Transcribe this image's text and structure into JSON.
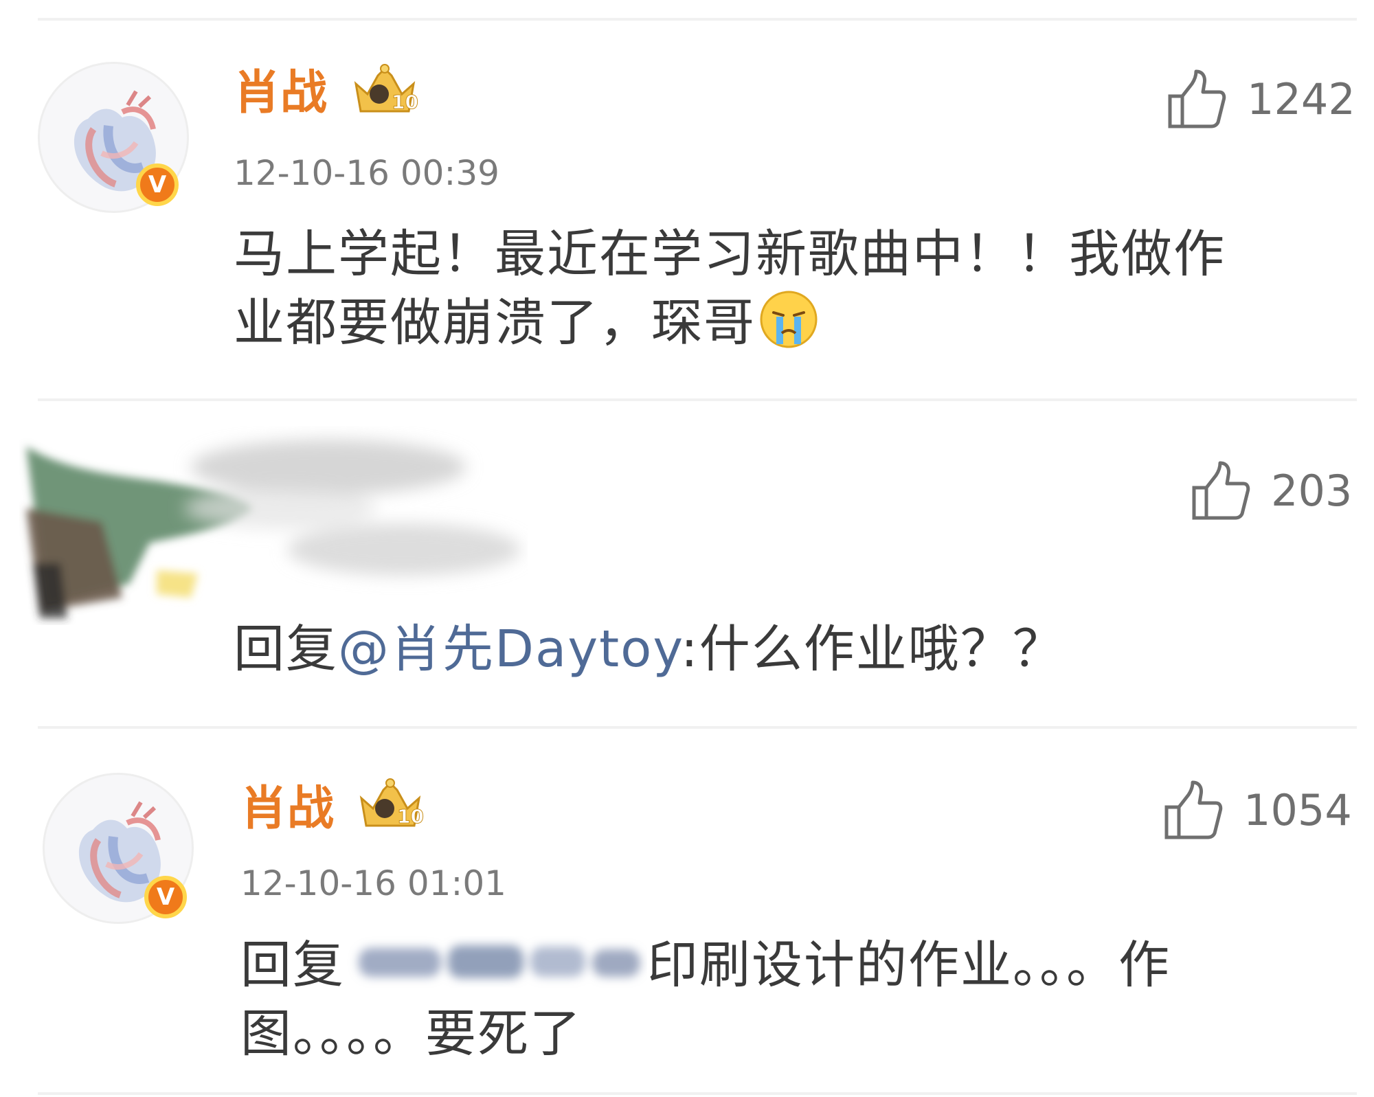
{
  "comments": [
    {
      "username": "肖战",
      "badge_icon": "vip-crown-level-10-icon",
      "badge_level": "10",
      "verified_icon": "verified-v-icon",
      "verified_letter": "V",
      "timestamp": "12-10-16 00:39",
      "likes": "1242",
      "text_line1": "马上学起！最近在学习新歌曲中！！我做作",
      "text_line2": "业都要做崩溃了，琛哥",
      "emoji": "crying-face-emoji"
    },
    {
      "username_hidden": true,
      "likes": "203",
      "reply_prefix": "回复",
      "mention": "@肖先Daytoy",
      "reply_text": ":什么作业哦？？"
    },
    {
      "username": "肖战",
      "badge_icon": "vip-crown-level-10-icon",
      "badge_level": "10",
      "verified_icon": "verified-v-icon",
      "verified_letter": "V",
      "timestamp": "12-10-16 01:01",
      "likes": "1054",
      "reply_prefix": "回复",
      "text_line1_rest": "印刷设计的作业。。。作",
      "text_line2": "图。。。。要死了"
    }
  ],
  "colors": {
    "username": "#e97b25",
    "mention": "#4f6a96",
    "text": "#3a3a3a",
    "meta": "#7a7a7a",
    "verified_bg": "#f07a1a"
  }
}
